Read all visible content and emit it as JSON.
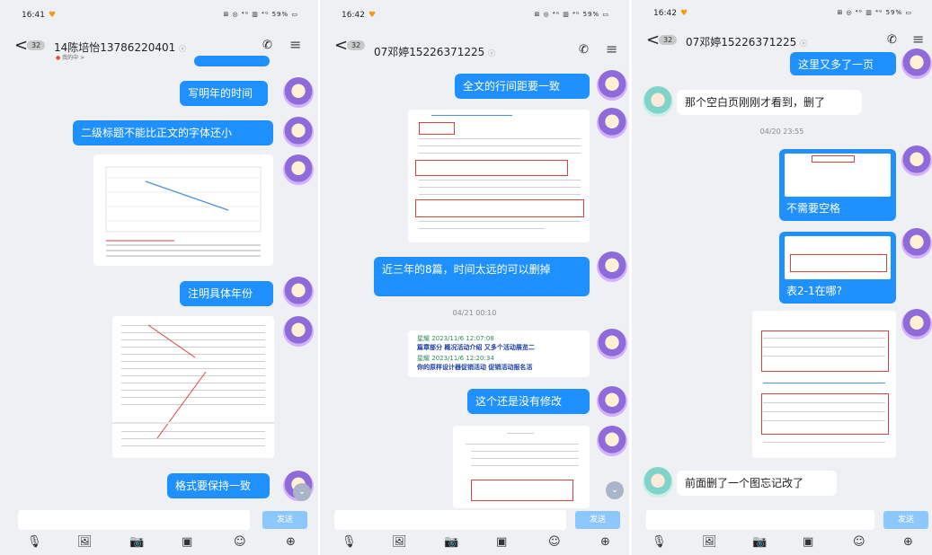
{
  "panels": [
    {
      "status_time": "16:41",
      "status_sys": "⊞ ◎ ⁴ᴳ ▥ ⁴ᴳ 59% ▭",
      "unread": "32",
      "title": "14陈培怡13786220401",
      "verified": "ⓥ",
      "subtitle": "我的中 >",
      "messages": [
        "写明年的时间",
        "二级标题不能比正文的字体还小",
        "注明具体年份",
        "格式要保持一致"
      ],
      "send_label": "发送"
    },
    {
      "status_time": "16:42",
      "status_sys": "⊞ ◎ ⁴ᴳ ▥ ⁴ᴳ 59% ▭",
      "unread": "32",
      "title": "07邓婷15226371225",
      "verified": "ⓥ",
      "messages": [
        "全文的行间距要一致",
        "近三年的8篇，时间太远的可以删掉",
        "这个还是没有修改"
      ],
      "timestamp": "04/21 00:10",
      "card": {
        "line1": "星耀 2023/11/6 12:07:08",
        "line2": "篇章部分  概况活动介绍 又多个活动展览二",
        "line3": "星耀 2023/11/6 12:20:34",
        "line4": "你的原样设计器促销活动  促销活动报名活"
      },
      "send_label": "发送"
    },
    {
      "status_time": "16:42",
      "status_sys": "⊞ ◎ ⁴ᴳ ▥ ⁴ᴳ 59% ▭",
      "unread": "32",
      "title": "07邓婷15226371225",
      "verified": "ⓥ",
      "messages": [
        "这里又多了一页",
        "那个空白页刚刚才看到，删了",
        "不需要空格",
        "表2-1在哪?",
        "前面删了一个图忘记改了"
      ],
      "timestamp": "04/20 23:55",
      "send_label": "发送"
    }
  ],
  "icons": [
    "voice-icon",
    "image-icon",
    "camera-icon",
    "file-icon",
    "emoji-icon",
    "plus-icon"
  ],
  "colors": {
    "bubble": "#1e90ff",
    "background": "#eef0f4",
    "send": "#8cc8ff"
  }
}
